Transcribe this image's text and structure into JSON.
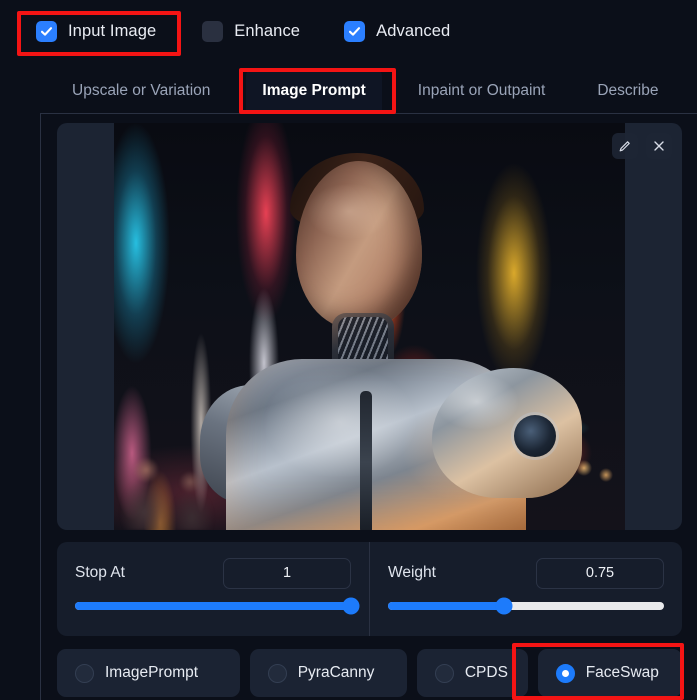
{
  "checkboxes": [
    {
      "label": "Input Image",
      "checked": true,
      "name": "input-image"
    },
    {
      "label": "Enhance",
      "checked": false,
      "name": "enhance"
    },
    {
      "label": "Advanced",
      "checked": true,
      "name": "advanced"
    }
  ],
  "tabs": [
    {
      "label": "Upscale or Variation",
      "active": false
    },
    {
      "label": "Image Prompt",
      "active": true
    },
    {
      "label": "Inpaint or Outpaint",
      "active": false
    },
    {
      "label": "Describe",
      "active": false
    }
  ],
  "image_panel": {
    "edit_icon": "pencil-icon",
    "close_icon": "close-icon",
    "description": "Uploaded reference photo: female cyborg in silver armor on a neon-lit Times Square street"
  },
  "sliders": [
    {
      "label": "Stop At",
      "value": "1",
      "fill_percent": 100,
      "thumb_percent": 100
    },
    {
      "label": "Weight",
      "value": "0.75",
      "fill_percent": 42,
      "thumb_percent": 42
    }
  ],
  "control_types": [
    {
      "label": "ImagePrompt",
      "selected": false
    },
    {
      "label": "PyraCanny",
      "selected": false
    },
    {
      "label": "CPDS",
      "selected": false
    },
    {
      "label": "FaceSwap",
      "selected": true
    }
  ],
  "annotations": [
    {
      "target": "Input Image",
      "color": "#f41414"
    },
    {
      "target": "Image Prompt",
      "color": "#f41414"
    },
    {
      "target": "FaceSwap",
      "color": "#f41414"
    }
  ],
  "colors": {
    "background": "#0b0f19",
    "accent": "#1d7bfb",
    "panel": "#161d2b",
    "annotation": "#f41414"
  }
}
